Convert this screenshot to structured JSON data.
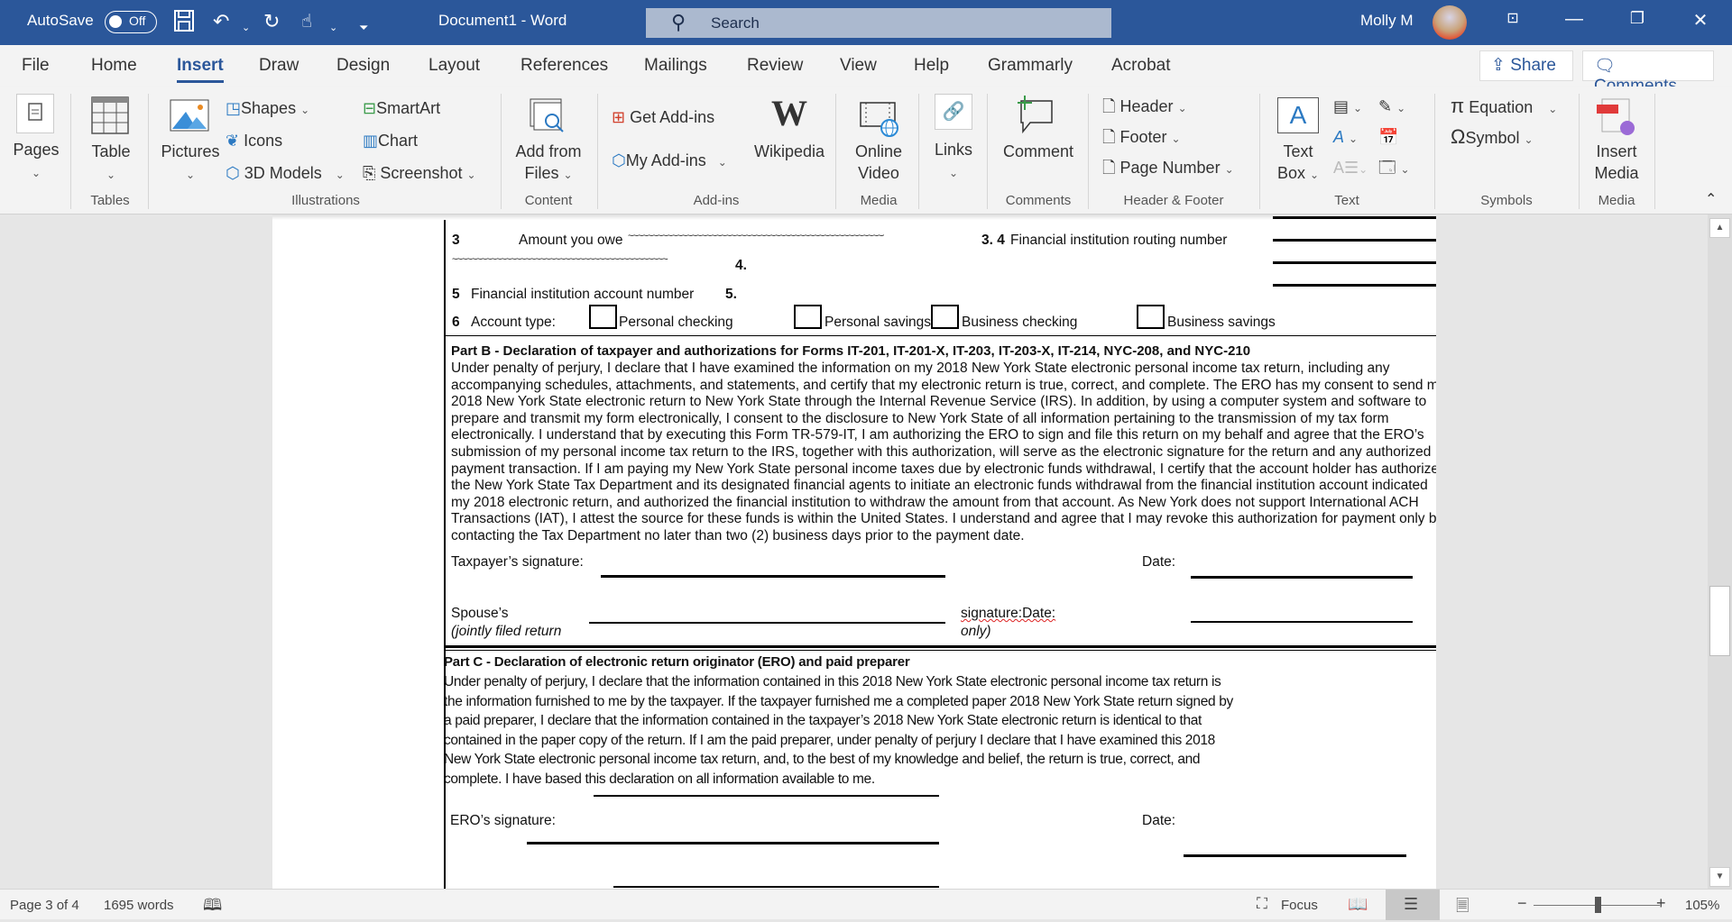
{
  "titlebar": {
    "autosave_label": "AutoSave",
    "autosave_state": "Off",
    "document_title": "Document1  -  Word",
    "search_placeholder": "Search",
    "user_name": "Molly M",
    "icons": [
      "save-icon",
      "undo-icon",
      "redo-icon",
      "touch-mode-icon",
      "customize-qat-icon",
      "ribbon-display-icon",
      "minimize-icon",
      "restore-icon",
      "close-icon"
    ]
  },
  "tabs": [
    {
      "label": "File"
    },
    {
      "label": "Home"
    },
    {
      "label": "Insert",
      "active": true
    },
    {
      "label": "Draw"
    },
    {
      "label": "Design"
    },
    {
      "label": "Layout"
    },
    {
      "label": "References"
    },
    {
      "label": "Mailings"
    },
    {
      "label": "Review"
    },
    {
      "label": "View"
    },
    {
      "label": "Help"
    },
    {
      "label": "Grammarly"
    },
    {
      "label": "Acrobat"
    }
  ],
  "top_buttons": {
    "share": "Share",
    "comments": "Comments"
  },
  "ribbon": {
    "pages": {
      "label": "Pages"
    },
    "tables": {
      "table": "Table",
      "group": "Tables"
    },
    "illustrations": {
      "pictures": "Pictures",
      "shapes": "Shapes",
      "icons": "Icons",
      "models": "3D Models",
      "smartart": "SmartArt",
      "chart": "Chart",
      "screenshot": "Screenshot",
      "group": "Illustrations"
    },
    "content": {
      "add_from_files_1": "Add from",
      "add_from_files_2": "Files",
      "group": "Content"
    },
    "addins": {
      "get": "Get Add-ins",
      "my": "My Add-ins",
      "wikipedia": "Wikipedia",
      "group": "Add-ins"
    },
    "media": {
      "online_video_1": "Online",
      "online_video_2": "Video",
      "group": "Media"
    },
    "links": {
      "label": "Links"
    },
    "comments": {
      "comment": "Comment",
      "group": "Comments"
    },
    "header_footer": {
      "header": "Header",
      "footer": "Footer",
      "page_number": "Page Number",
      "group": "Header & Footer"
    },
    "text": {
      "text_box_1": "Text",
      "text_box_2": "Box",
      "group": "Text"
    },
    "symbols": {
      "equation": "Equation",
      "symbol": "Symbol",
      "group": "Symbols"
    },
    "media2": {
      "insert_media_1": "Insert",
      "insert_media_2": "Media",
      "group": "Media"
    }
  },
  "document": {
    "row3_num": "3",
    "row3_label": "Amount you owe",
    "row3_dots": "~~~~~~~~~~~~~~~~~~~~~~~~~~~~~~~~~~~~~~~~~~~~~~~~~~~~~~~~~",
    "row3_ref": "3. 4",
    "row4_label": "Financial institution routing number",
    "row4_dots": "~~~~~~~~~~~~~~~~~~~~~~~~~~~~~~~~~~~~~~~~~~~~",
    "row4_ref": "4.",
    "row5_num": "5",
    "row5_label": "Financial institution account number",
    "row5_ref": "5.",
    "row6_num": "6",
    "row6_label": "Account type:",
    "account_types": [
      "Personal checking",
      "Personal savings",
      "Business checking",
      "Business savings"
    ],
    "partB_title": "Part B - Declaration of taxpayer and authorizations for Forms IT-201, IT-201-X, IT-203, IT-203-X, IT-214, NYC-208, and NYC-210",
    "partB_lines": [
      "Under penalty of perjury, I declare that I have examined the information on my 2018 New York State electronic personal income tax return, including any",
      "accompanying schedules, attachments, and statements, and certify that my electronic return is true, correct, and complete. The ERO has my consent to send my",
      "2018 New York State electronic return to New York State through the Internal Revenue Service (IRS). In addition, by using a computer system and software to",
      "prepare and transmit my form electronically, I consent to the disclosure to New York State of all information pertaining to the transmission of my tax form",
      "electronically. I understand that by executing this Form TR-579-IT, I am authorizing the ERO to sign and file this return on my behalf and agree that the ERO’s",
      "submission of my personal income tax return to the IRS, together with this authorization, will serve as the electronic signature for the return and any authorized",
      "payment transaction. If I am paying my New York State personal income taxes due by electronic funds withdrawal, I certify that the account holder has authorized",
      "the New York State Tax Department and its designated financial agents to initiate an electronic funds withdrawal from the financial institution account indicated",
      "my 2018 electronic return, and authorized the financial institution to withdraw the amount from that account. As New York does not support International ACH",
      "Transactions (IAT), I attest the source for these funds is within the United States. I understand and agree that I may revoke this authorization for payment only by",
      "contacting the Tax Department no later than two (2) business days prior to the payment date."
    ],
    "taxpayer_signature": "Taxpayer’s signature:",
    "date_label": "Date:",
    "spouse_label": "Spouse’s",
    "spouse_sub": "(jointly filed return",
    "spouse_sig_date": "signature:Date:",
    "spouse_only": "only)",
    "partC_title": "Part C - Declaration of electronic return originator (ERO) and paid preparer",
    "partC_lines": [
      "Under penalty of perjury, I declare that the information contained in this 2018 New York State electronic personal income tax return is",
      "the information furnished to me by the taxpayer. If the taxpayer furnished me a completed paper 2018 New York State return signed by",
      "a paid preparer, I declare that the information contained in the taxpayer’s 2018 New York State electronic return is identical to that",
      "contained in the paper copy of the return. If I am the paid preparer, under penalty of perjury I declare that I have examined this 2018",
      "New York State electronic personal income tax return, and, to the best of my knowledge and belief, the return is true, correct, and",
      "complete. I have based this declaration on all information available to me."
    ],
    "ero_signature": "ERO’s signature:",
    "ero_date": "Date:"
  },
  "statusbar": {
    "page": "Page 3 of 4",
    "words": "1695 words",
    "focus": "Focus",
    "zoom": "105%",
    "zoom_percent": 105
  }
}
